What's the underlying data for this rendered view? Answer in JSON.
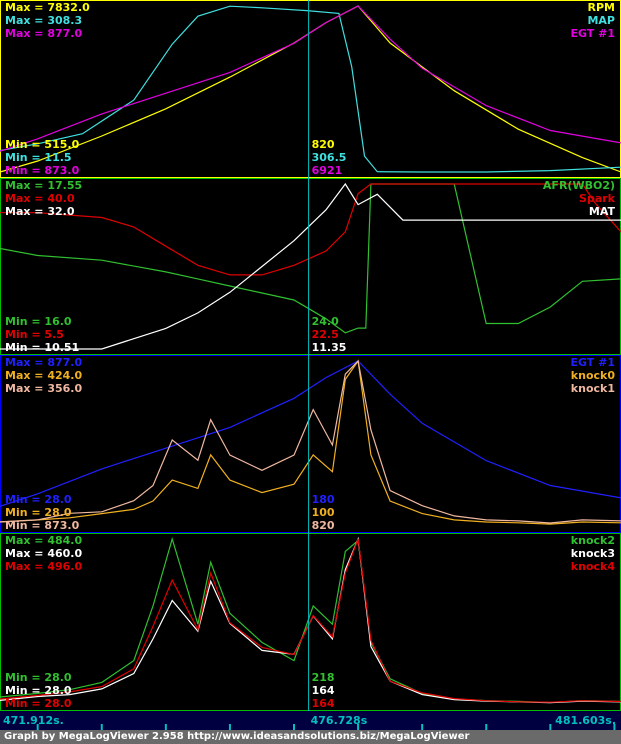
{
  "timeline": {
    "start": "471.912s.",
    "cursor": "476.728s",
    "end": "481.603s.",
    "tick_times": [
      472.5,
      473.5,
      474.5,
      475.5,
      476.5,
      477.5,
      478.5,
      479.5,
      480.5,
      481.5
    ]
  },
  "footer_text": "Graph by MegaLogViewer 2.958 http://www.ideasandsolutions.biz/MegaLogViewer",
  "colors": {
    "background": "#000000",
    "border_yellow": "#ffff00",
    "border_green": "#00c000",
    "border_blue": "#0000ff",
    "cursor_line": "#00c0c0",
    "timeline_bar": "#000040",
    "timeline_text": "#00c0c0",
    "footer_bg": "#6a6a6a"
  },
  "chart_data": [
    {
      "type": "line",
      "panel": "top",
      "border": "#ffff00",
      "x_range": [
        471.912,
        481.603
      ],
      "cursor_x": 476.728,
      "max_labels": [
        "Max = 7832.0",
        "Max = 308.3",
        "Max = 877.0"
      ],
      "min_labels": [
        "Min = 515.0",
        "Min = 11.5",
        "Min = 873.0"
      ],
      "cursor_values": [
        "820",
        "306.5",
        "6921"
      ],
      "series": [
        {
          "name": "RPM",
          "color": "#ffff00",
          "min": 515,
          "max": 7832,
          "x": [
            471.912,
            472.5,
            473.5,
            474.5,
            475.5,
            476.5,
            477.0,
            477.5,
            478.0,
            479.0,
            480.0,
            481.0,
            481.603
          ],
          "y": [
            515,
            1000,
            2100,
            3300,
            4700,
            6200,
            7100,
            7832,
            6200,
            4100,
            2400,
            1150,
            515
          ]
        },
        {
          "name": "MAP",
          "color": "#40e0e0",
          "min": 11.5,
          "max": 308.3,
          "x": [
            471.912,
            472.5,
            473.2,
            474.0,
            474.6,
            475.0,
            475.5,
            476.0,
            476.7,
            477.2,
            477.4,
            477.6,
            477.8,
            478.5,
            479.5,
            480.5,
            481.603
          ],
          "y": [
            50,
            62,
            80,
            140,
            240,
            290,
            308,
            305,
            300,
            295,
            200,
            40,
            12,
            11.5,
            11.5,
            14,
            20
          ]
        },
        {
          "name": "EGT #1",
          "color": "#e000e0",
          "min": 873,
          "max": 877,
          "x": [
            471.912,
            472.5,
            473.5,
            474.5,
            475.5,
            476.5,
            477.0,
            477.5,
            478.0,
            478.5,
            479.5,
            480.5,
            481.603
          ],
          "y": [
            873.5,
            873.8,
            874.4,
            874.9,
            875.4,
            876.1,
            876.6,
            877.0,
            876.2,
            875.5,
            874.6,
            874.0,
            873.7
          ]
        }
      ]
    },
    {
      "type": "line",
      "panel": "second",
      "border": "#00c000",
      "x_range": [
        471.912,
        481.603
      ],
      "cursor_x": 476.728,
      "max_labels": [
        "Max = 17.55",
        "Max = 40.0",
        "Max = 32.0"
      ],
      "min_labels": [
        "Min = 16.0",
        "Min = 5.5",
        "Min = 10.51"
      ],
      "cursor_values": [
        "24.0",
        "22.5",
        "11.35"
      ],
      "series": [
        {
          "name": "AFR(WBO2)",
          "color": "#30c030",
          "min": 10.51,
          "max": 17.55,
          "x": [
            471.912,
            472.5,
            473.5,
            474.5,
            475.0,
            475.5,
            476.0,
            476.5,
            477.0,
            477.3,
            477.5,
            477.62,
            477.7,
            478.5,
            479.0,
            479.5,
            480.0,
            480.5,
            481.0,
            481.603
          ],
          "y": [
            14.8,
            14.5,
            14.3,
            13.8,
            13.5,
            13.2,
            12.9,
            12.6,
            11.8,
            11.2,
            11.4,
            11.4,
            17.55,
            17.55,
            17.55,
            11.6,
            11.6,
            12.3,
            13.4,
            13.5
          ]
        },
        {
          "name": "Spark",
          "color": "#e00000",
          "min": 5.5,
          "max": 40.0,
          "x": [
            471.912,
            472.5,
            473.5,
            474.0,
            474.5,
            475.0,
            475.5,
            476.0,
            476.5,
            477.0,
            477.3,
            477.5,
            477.7,
            478.5,
            479.5,
            480.5,
            481.0,
            481.2,
            481.603
          ],
          "y": [
            34,
            34,
            33,
            31,
            27,
            23,
            21,
            21,
            23,
            26,
            30,
            38,
            40,
            40,
            40,
            40,
            40,
            36,
            30
          ]
        },
        {
          "name": "MAT",
          "color": "#ffffff",
          "min": 16.0,
          "max": 32.0,
          "x": [
            471.912,
            473.5,
            474.0,
            474.5,
            475.0,
            475.5,
            476.0,
            476.5,
            477.0,
            477.3,
            477.5,
            477.8,
            478.2,
            478.6,
            479.5,
            480.5,
            481.603
          ],
          "y": [
            16.0,
            16.0,
            17.0,
            18.0,
            19.5,
            21.5,
            24.0,
            26.5,
            29.5,
            32.0,
            30.0,
            31.0,
            28.5,
            28.5,
            28.5,
            28.5,
            28.5
          ]
        }
      ]
    },
    {
      "type": "line",
      "panel": "third",
      "border": "#0000ff",
      "x_range": [
        471.912,
        481.603
      ],
      "cursor_x": 476.728,
      "max_labels": [
        "Max = 877.0",
        "Max = 424.0",
        "Max = 356.0"
      ],
      "min_labels": [
        "Min = 28.0",
        "Min = 28.0",
        "Min = 873.0"
      ],
      "cursor_values": [
        "180",
        "100",
        "820"
      ],
      "series": [
        {
          "name": "EGT #1",
          "color": "#2020ff",
          "min": 873,
          "max": 877,
          "x": [
            471.912,
            472.5,
            473.5,
            474.5,
            475.5,
            476.5,
            477.0,
            477.5,
            478.0,
            478.5,
            479.5,
            480.5,
            481.603
          ],
          "y": [
            873.5,
            873.8,
            874.4,
            874.9,
            875.4,
            876.1,
            876.6,
            877.0,
            876.2,
            875.5,
            874.6,
            874.0,
            873.7
          ]
        },
        {
          "name": "knock0",
          "color": "#f0b020",
          "min": 28,
          "max": 424,
          "x": [
            471.912,
            472.5,
            473.0,
            473.5,
            474.0,
            474.3,
            474.6,
            475.0,
            475.2,
            475.5,
            476.0,
            476.5,
            476.8,
            477.1,
            477.3,
            477.5,
            477.7,
            478.0,
            478.5,
            479.0,
            479.5,
            480.0,
            480.5,
            481.0,
            481.603
          ],
          "y": [
            40,
            45,
            50,
            60,
            70,
            90,
            140,
            120,
            200,
            140,
            110,
            130,
            200,
            160,
            380,
            424,
            200,
            90,
            60,
            45,
            40,
            38,
            35,
            40,
            38
          ]
        },
        {
          "name": "knock1",
          "color": "#f0b8a0",
          "min": 28,
          "max": 356,
          "x": [
            471.912,
            472.5,
            473.0,
            473.5,
            474.0,
            474.3,
            474.6,
            475.0,
            475.2,
            475.5,
            476.0,
            476.5,
            476.8,
            477.1,
            477.3,
            477.5,
            477.7,
            478.0,
            478.5,
            479.0,
            479.5,
            480.0,
            480.5,
            481.0,
            481.603
          ],
          "y": [
            38,
            42,
            55,
            58,
            80,
            110,
            200,
            160,
            240,
            170,
            140,
            170,
            260,
            190,
            330,
            356,
            220,
            100,
            70,
            50,
            42,
            40,
            36,
            42,
            40
          ]
        }
      ]
    },
    {
      "type": "line",
      "panel": "bottom",
      "border": "#00c000",
      "x_range": [
        471.912,
        481.603
      ],
      "cursor_x": 476.728,
      "max_labels": [
        "Max = 484.0",
        "Max = 460.0",
        "Max = 496.0"
      ],
      "min_labels": [
        "Min = 28.0",
        "Min = 28.0",
        "Min = 28.0"
      ],
      "cursor_values": [
        "218",
        "164",
        "164"
      ],
      "series": [
        {
          "name": "knock2",
          "color": "#30c030",
          "min": 28,
          "max": 484,
          "x": [
            471.912,
            472.5,
            473.0,
            473.5,
            474.0,
            474.3,
            474.6,
            475.0,
            475.2,
            475.5,
            476.0,
            476.5,
            476.8,
            477.1,
            477.3,
            477.5,
            477.7,
            478.0,
            478.5,
            479.0,
            479.5,
            480.0,
            480.5,
            481.0,
            481.603
          ],
          "y": [
            50,
            60,
            70,
            90,
            150,
            300,
            484,
            250,
            420,
            280,
            200,
            150,
            300,
            250,
            450,
            480,
            200,
            100,
            60,
            45,
            40,
            38,
            35,
            40,
            38
          ]
        },
        {
          "name": "knock3",
          "color": "#ffffff",
          "min": 28,
          "max": 460,
          "x": [
            471.912,
            472.5,
            473.0,
            473.5,
            474.0,
            474.3,
            474.6,
            475.0,
            475.2,
            475.5,
            476.0,
            476.5,
            476.8,
            477.1,
            477.3,
            477.5,
            477.7,
            478.0,
            478.5,
            479.0,
            479.5,
            480.0,
            480.5,
            481.0,
            481.603
          ],
          "y": [
            40,
            50,
            55,
            70,
            110,
            200,
            300,
            220,
            350,
            240,
            170,
            160,
            260,
            200,
            380,
            460,
            180,
            90,
            55,
            42,
            38,
            36,
            34,
            38,
            36
          ]
        },
        {
          "name": "knock4",
          "color": "#e00000",
          "min": 28,
          "max": 496,
          "x": [
            471.912,
            472.5,
            473.0,
            473.5,
            474.0,
            474.3,
            474.6,
            475.0,
            475.2,
            475.5,
            476.0,
            476.5,
            476.8,
            477.1,
            477.3,
            477.5,
            477.7,
            478.0,
            478.5,
            479.0,
            479.5,
            480.0,
            480.5,
            481.0,
            481.603
          ],
          "y": [
            45,
            55,
            65,
            80,
            130,
            250,
            380,
            240,
            400,
            260,
            190,
            170,
            280,
            220,
            400,
            496,
            210,
            95,
            62,
            46,
            40,
            37,
            36,
            40,
            38
          ]
        }
      ]
    }
  ]
}
